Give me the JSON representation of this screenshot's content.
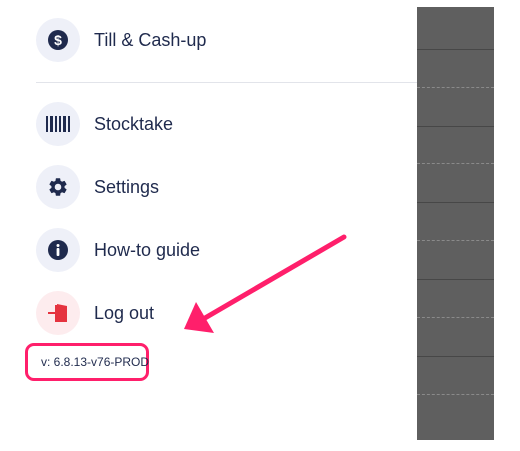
{
  "menu": {
    "items": [
      {
        "label": "Till & Cash-up",
        "icon": "dollar-icon"
      },
      {
        "label": "Stocktake",
        "icon": "barcode-icon"
      },
      {
        "label": "Settings",
        "icon": "gear-icon"
      },
      {
        "label": "How-to guide",
        "icon": "info-icon"
      },
      {
        "label": "Log out",
        "icon": "logout-icon"
      }
    ]
  },
  "version": "v: 6.8.13-v76-PROD",
  "colors": {
    "text": "#1f2a4d",
    "icon_bg": "#eef0f8",
    "logout_bg": "#fdecee",
    "logout_icon": "#e5333f",
    "highlight": "#ff1f6b",
    "overlay": "#5f5f5f"
  }
}
